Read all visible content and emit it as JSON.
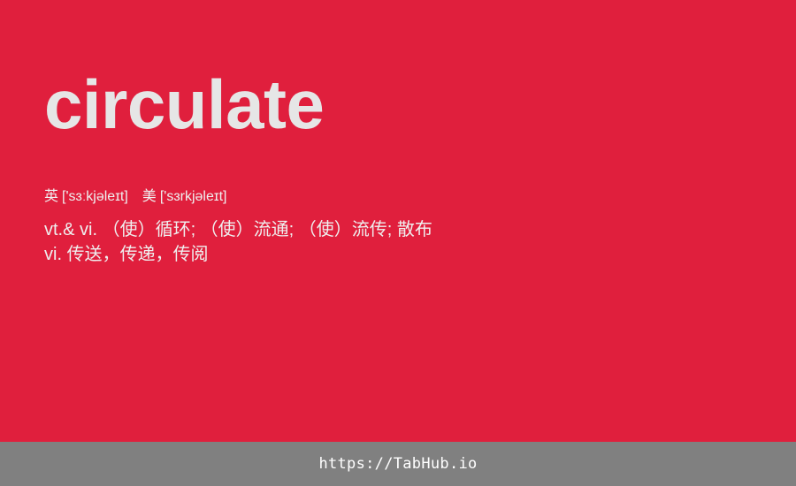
{
  "entry": {
    "word": "circulate",
    "phonetics": {
      "uk_label": "英",
      "uk_ipa": "['sɜːkjəleɪt]",
      "us_label": "美",
      "us_ipa": "['sɜrkjəleɪt]"
    },
    "definitions": [
      "vt.& vi. （使）循环; （使）流通; （使）流传; 散布",
      "vi. 传送，传递，传阅"
    ]
  },
  "footer": {
    "link_text": "https://TabHub.io"
  },
  "colors": {
    "card_background": "#E01F3D",
    "word_text": "#E6E6E6",
    "footer_background": "#808080",
    "footer_text": "#FFFFFF"
  }
}
